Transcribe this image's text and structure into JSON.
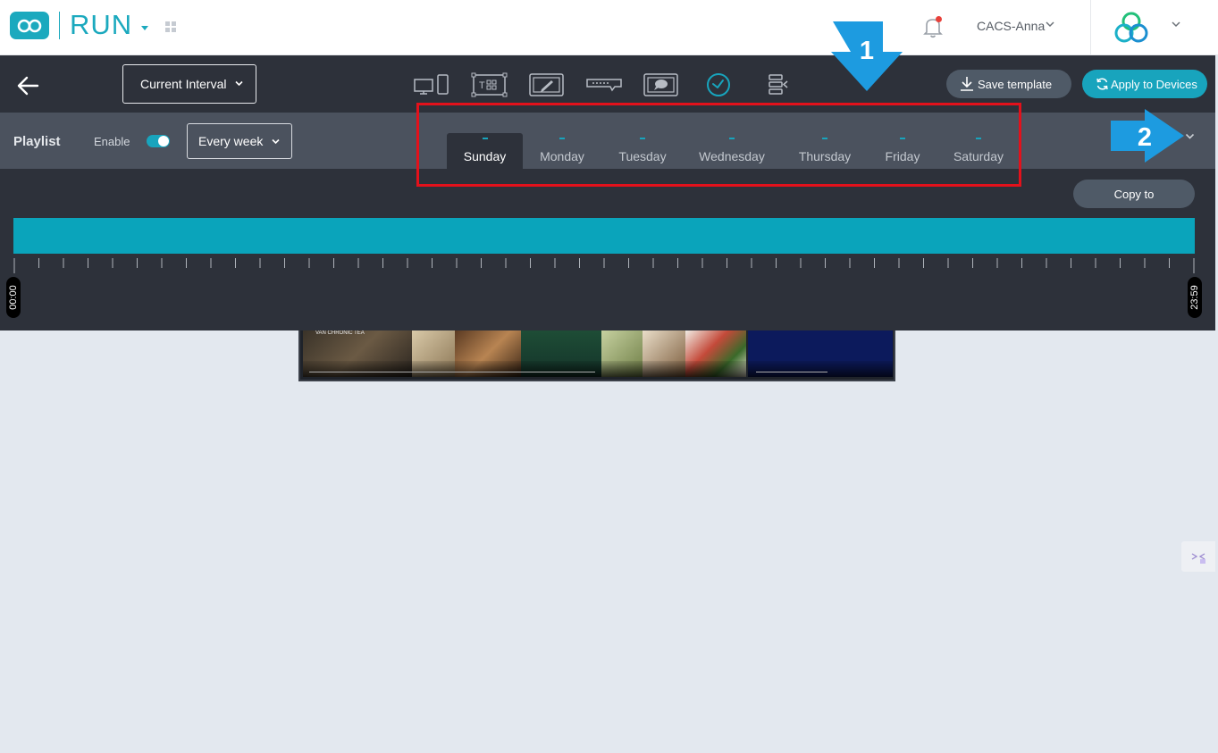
{
  "app": {
    "brand": "RUN",
    "user_name": "CACS-Anna"
  },
  "toolbar": {
    "interval_label": "Current Interval",
    "tools": [
      "display-devices-icon",
      "text-widget-icon",
      "draw-icon",
      "ticker-icon",
      "message-icon",
      "clock-icon",
      "align-icon"
    ],
    "active_tool": "clock-icon",
    "save_label": "Save template",
    "apply_label": "Apply to Devices"
  },
  "playlist": {
    "label": "Playlist",
    "enable_label": "Enable",
    "enabled": true,
    "repeat_label": "Every week",
    "days": [
      {
        "name": "Sunday",
        "value": "-"
      },
      {
        "name": "Monday",
        "value": "-"
      },
      {
        "name": "Tuesday",
        "value": "-"
      },
      {
        "name": "Wednesday",
        "value": "-"
      },
      {
        "name": "Thursday",
        "value": "-"
      },
      {
        "name": "Friday",
        "value": "-"
      },
      {
        "name": "Saturday",
        "value": "-"
      }
    ],
    "active_day": "Sunday"
  },
  "timeline": {
    "copy_label": "Copy to",
    "start_time": "00:00",
    "end_time": "23:59"
  },
  "preview": {
    "title": "VAN CHRONIC TEA"
  },
  "annotations": {
    "arrow1_label": "1",
    "arrow2_label": "2",
    "highlight_color": "#e3111b",
    "arrow_color": "#1d9be0"
  },
  "colors": {
    "accent": "#18a4bd",
    "toolbar_bg": "#2d313a",
    "playlist_bg": "#4b525e",
    "page_bg": "#e3e8ef"
  }
}
